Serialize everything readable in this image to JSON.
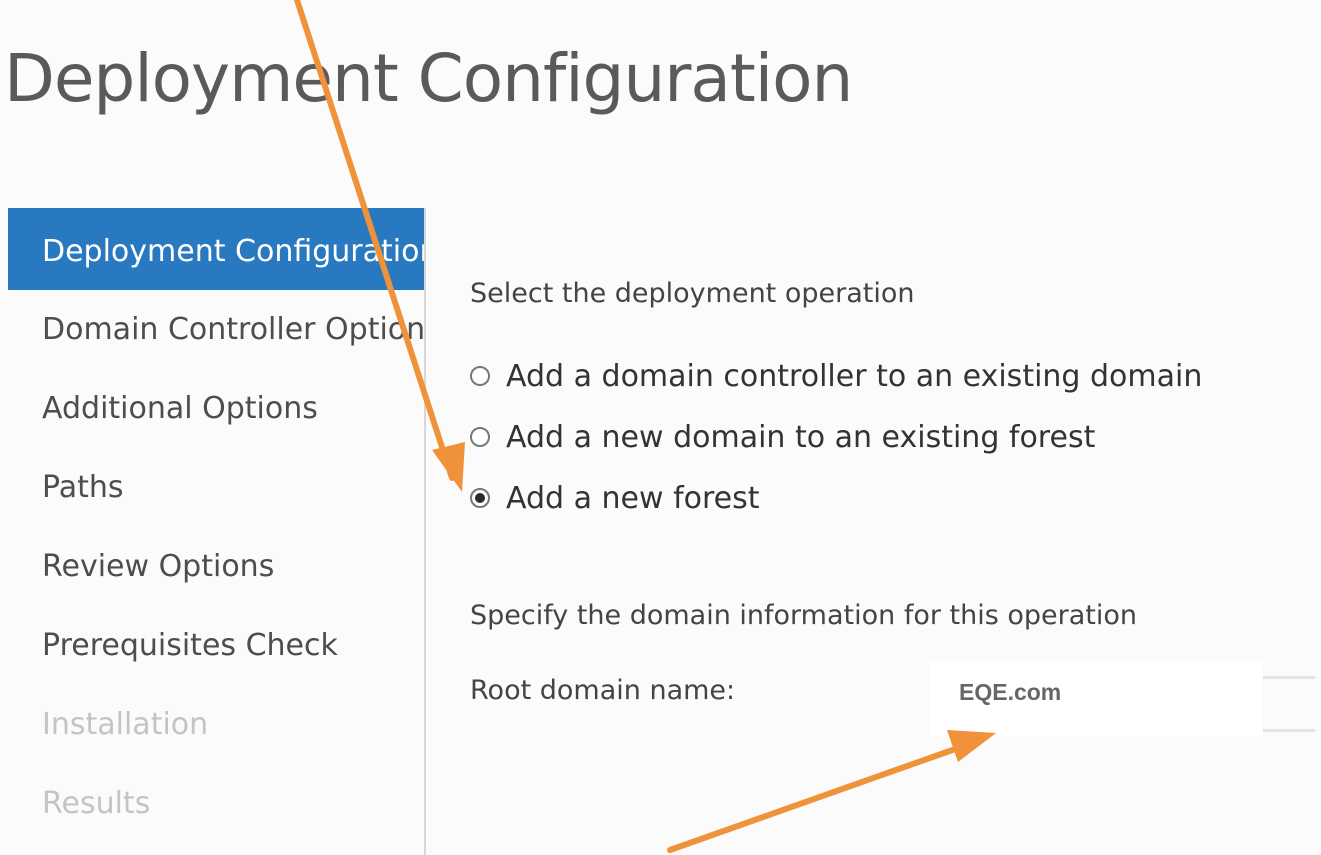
{
  "page": {
    "title": "Deployment Configuration"
  },
  "sidebar": {
    "items": [
      {
        "label": "Deployment Configuration",
        "state": "active"
      },
      {
        "label": "Domain Controller Options",
        "state": "normal"
      },
      {
        "label": "Additional Options",
        "state": "normal"
      },
      {
        "label": "Paths",
        "state": "normal"
      },
      {
        "label": "Review Options",
        "state": "normal"
      },
      {
        "label": "Prerequisites Check",
        "state": "normal"
      },
      {
        "label": "Installation",
        "state": "disabled"
      },
      {
        "label": "Results",
        "state": "disabled"
      }
    ]
  },
  "main": {
    "operation_heading": "Select the deployment operation",
    "options": [
      {
        "label": "Add a domain controller to an existing domain",
        "selected": false
      },
      {
        "label": "Add a new domain to an existing forest",
        "selected": false
      },
      {
        "label": "Add a new forest",
        "selected": true
      }
    ],
    "domain_heading": "Specify the domain information for this operation",
    "root_domain_label": "Root domain name:",
    "root_domain_value": "EQE.com"
  },
  "annotations": {
    "arrow_color": "#f0923a",
    "accent_color": "#2979c1"
  }
}
